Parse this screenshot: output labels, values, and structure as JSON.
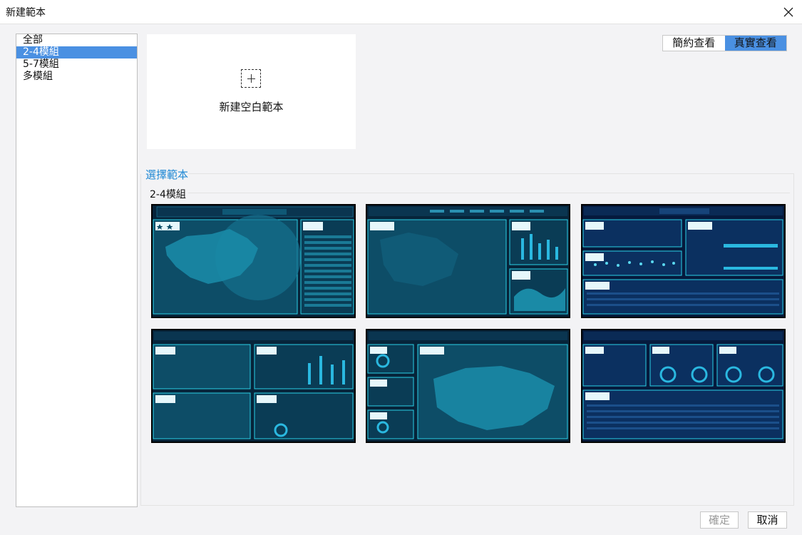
{
  "window": {
    "title": "新建範本"
  },
  "categories": [
    "全部",
    "2-4模組",
    "5-7模組",
    "多模組"
  ],
  "selected_category_index": 1,
  "new_template": {
    "label": "新建空白範本"
  },
  "view_toggle": {
    "simple": "簡約查看",
    "detail": "真實查看",
    "active": "detail"
  },
  "section": {
    "label": "選擇範本"
  },
  "group": {
    "label": "2-4模組"
  },
  "templates": [
    {
      "bg": "#06243a"
    },
    {
      "bg": "#06243a"
    },
    {
      "bg": "#051a3d"
    },
    {
      "bg": "#06243a"
    },
    {
      "bg": "#06243a"
    },
    {
      "bg": "#051a3d"
    }
  ],
  "footer": {
    "confirm": "確定",
    "cancel": "取消",
    "confirm_disabled": true
  },
  "colors": {
    "accent": "#4a90e2",
    "link": "#1e88d4",
    "thumb_panel": "#0f6a84",
    "thumb_border": "#2ad0e6"
  }
}
